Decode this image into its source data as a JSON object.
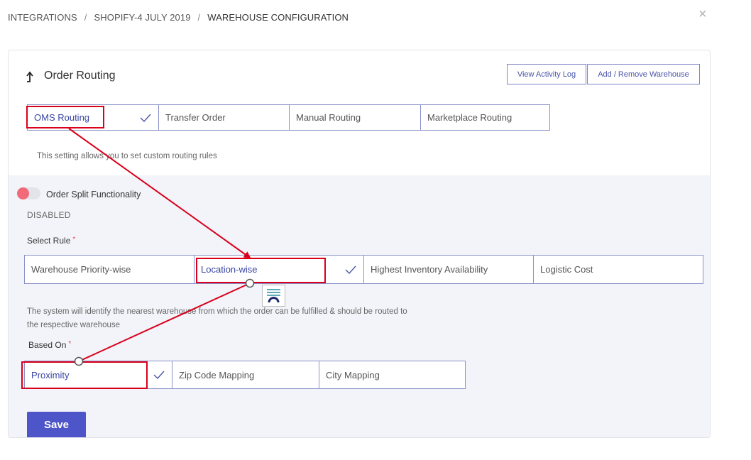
{
  "breadcrumb": {
    "items": [
      "INTEGRATIONS",
      "SHOPIFY-4 JULY 2019",
      "WAREHOUSE CONFIGURATION"
    ],
    "separator": "/"
  },
  "close_icon": "×",
  "header": {
    "title": "Order Routing",
    "view_activity_log": "View Activity Log",
    "add_remove_warehouse": "Add / Remove Warehouse"
  },
  "routing_tabs": {
    "options": [
      "OMS Routing",
      "Transfer Order",
      "Manual Routing",
      "Marketplace Routing"
    ],
    "selected": "OMS Routing",
    "hint": "This setting allows you to set custom routing rules"
  },
  "split": {
    "label": "Order Split Functionality",
    "status": "DISABLED"
  },
  "select_rule": {
    "label": "Select Rule",
    "required_mark": "*",
    "options": [
      "Warehouse Priority-wise",
      "Location-wise",
      "Highest Inventory Availability",
      "Logistic Cost"
    ],
    "selected": "Location-wise",
    "description_line1": "The system will identify the nearest warehouse from which the order can be fulfilled & should be routed to",
    "description_line2": "the respective warehouse"
  },
  "based_on": {
    "label": "Based On",
    "required_mark": "*",
    "options": [
      "Proximity",
      "Zip Code Mapping",
      "City Mapping"
    ],
    "selected": "Proximity"
  },
  "save_label": "Save",
  "colors": {
    "accent": "#4e55c8",
    "annotation": "#d9001b",
    "toggle_knob": "#f26a7a"
  }
}
